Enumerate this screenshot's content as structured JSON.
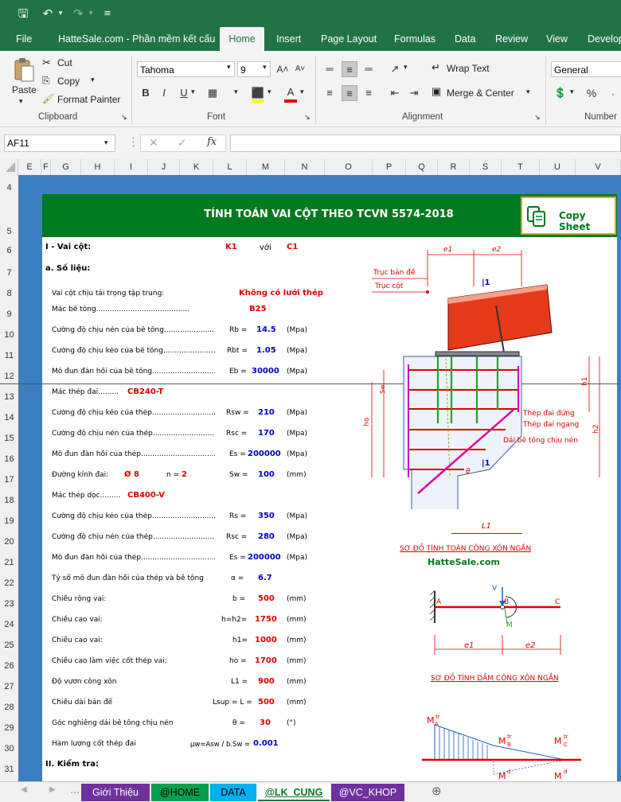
{
  "ribbon_tabs": [
    "File",
    "HatteSale.com - Phần mềm kết cấu",
    "Home",
    "Insert",
    "Page Layout",
    "Formulas",
    "Data",
    "Review",
    "View",
    "Developer"
  ],
  "clipboard": {
    "paste": "Paste",
    "cut": "Cut",
    "copy": "Copy",
    "format_painter": "Format Painter",
    "group": "Clipboard"
  },
  "font": {
    "name": "Tahoma",
    "size": "9",
    "group": "Font",
    "bold": "B",
    "italic": "I",
    "underline": "U"
  },
  "alignment": {
    "wrap": "Wrap Text",
    "merge": "Merge & Center",
    "group": "Alignment"
  },
  "number": {
    "format": "General",
    "group": "Number",
    "percent": "%"
  },
  "name_box": "AF11",
  "formula_value": "",
  "col_headers": [
    "E",
    "F",
    "G",
    "H",
    "I",
    "J",
    "K",
    "L",
    "M",
    "N",
    "O",
    "P",
    "Q",
    "R",
    "S",
    "T",
    "U",
    "V"
  ],
  "row_headers": [
    "4",
    "5",
    "6",
    "7",
    "8",
    "9",
    "10",
    "11",
    "12",
    "13",
    "14",
    "15",
    "16",
    "17",
    "18",
    "19",
    "20",
    "21",
    "22",
    "23",
    "24",
    "25",
    "26",
    "27",
    "28",
    "29",
    "30",
    "31"
  ],
  "title": "TÍNH TOÁN VAI CỘT THEO TCVN 5574-2018",
  "copy_sheet": "Copy Sheet",
  "section1": {
    "label": "I - Vai cột:",
    "k": "K1",
    "with": "với",
    "c": "C1",
    "sub": "a.  Số liệu:"
  },
  "rows": [
    {
      "label": "Vai cột chịu tải trọng tập trung:",
      "value": "Không có lưới thép"
    },
    {
      "label": "Mác bê tông.........................................",
      "value": "B25"
    },
    {
      "label": "Cường độ chịu nén của bê tông.......................",
      "sym": "Rb =",
      "value": "14.5",
      "unit": "(Mpa)"
    },
    {
      "label": "Cường độ chịu kéo của bê tông.......................",
      "sym": "Rbt =",
      "value": "1.05",
      "unit": "(Mpa)"
    },
    {
      "label": "Mô đun đàn hồi của bê tông.............................",
      "sym": "Eb =",
      "value": "30000",
      "unit": "(Mpa)"
    },
    {
      "label": "Mác thép đai.........",
      "value": "CB240-T"
    },
    {
      "label": "Cường độ chịu kéo của thép............................",
      "sym": "Rsw =",
      "value": "210",
      "unit": "(Mpa)"
    },
    {
      "label": "Cường độ chịu nén của thép............................",
      "sym": "Rsc =",
      "value": "170",
      "unit": "(Mpa)"
    },
    {
      "label": "Mô đun đàn hồi của thép.................................",
      "sym": "Es =",
      "value": "200000",
      "unit": "(Mpa)"
    },
    {
      "label": "Đường kính đai:",
      "dia": "Ø 8",
      "n": "n =",
      "nval": "2",
      "sym": "Sw =",
      "value": "100",
      "unit": "(mm)"
    },
    {
      "label": "Mác thép dọc.........",
      "value": "CB400-V"
    },
    {
      "label": "Cường độ chịu kéo của thép............................",
      "sym": "Rs =",
      "value": "350",
      "unit": "(Mpa)"
    },
    {
      "label": "Cường độ chịu nén của thép............................",
      "sym": "Rsc =",
      "value": "280",
      "unit": "(Mpa)"
    },
    {
      "label": "Mô đun đàn hồi của thép.................................",
      "sym": "Es =",
      "value": "200000",
      "unit": "(Mpa)"
    },
    {
      "label": "Tỷ số mô đun đàn hồi của thép và bê tông",
      "sym": "α =",
      "value": "6.7",
      "unit": ""
    },
    {
      "label": "Chiều rộng vai:",
      "sym": "b =",
      "value": "500",
      "unit": "(mm)"
    },
    {
      "label": "Chiều cao vai:",
      "sym": "h=h2=",
      "value": "1750",
      "unit": "(mm)"
    },
    {
      "label": "Chiều cao vai:",
      "sym": "h1=",
      "value": "1000",
      "unit": "(mm)"
    },
    {
      "label": "Chiều cao làm việc cốt thép vai:",
      "sym": "ho =",
      "value": "1700",
      "unit": "(mm)"
    },
    {
      "label": "Độ vươn công xôn",
      "sym": "L1 =",
      "value": "900",
      "unit": "(mm)"
    },
    {
      "label": "Chiều dài bản đế",
      "sym": "Lsup = L =",
      "value": "500",
      "unit": "(mm)"
    },
    {
      "label": "Góc nghiêng dải bê tông chịu nén",
      "sym": "θ =",
      "value": "30",
      "unit": "(°)"
    },
    {
      "label": "Hàm lượng cốt thép đai",
      "sym": "μw=Asw / b.Sw =",
      "value": "0.001",
      "unit": ""
    }
  ],
  "section2": "II. Kiểm tra:",
  "diagram1": {
    "truc_ban_de": "Trục bản đế",
    "truc_cot": "Trục cột",
    "thep_dai_dung": "Thép đai đứng",
    "thep_dai_ngang": "Thép đai ngang",
    "dai_be_tong": "Dải bê tông chịu nén",
    "e1": "e1",
    "e2": "e2",
    "i1": "|1",
    "i1b": "|1",
    "h1": "h1",
    "h2": "h2",
    "ho": "ho",
    "l1": "L1",
    "theta": "θ",
    "sw": "Sw",
    "caption": "SƠ ĐỒ TÍNH TOÁN CÔNG XÔN NGẮN",
    "site": "HatteSale.com"
  },
  "diagram2": {
    "a": "A",
    "b": "B",
    "c": "C",
    "v": "V",
    "m": "M",
    "e1": "e1",
    "e2": "e2",
    "caption": "SƠ ĐỒ TÍNH DẦM CÔNG XÔN NGẮN"
  },
  "diagram3": {
    "ma": "M",
    "ma_sub": "A",
    "ma_sup": "tr",
    "mb": "M",
    "mb_sub": "B",
    "mb_sup": "tr",
    "mc": "M",
    "mc_sub": "C",
    "mc_sup": "tr",
    "md": "M",
    "md_sup": "d",
    "md2": "M",
    "md2_sup": "d"
  },
  "sheet_tabs": [
    "Giới Thiệu",
    "@HOME",
    "DATA",
    "@LK_CUNG",
    "@VC_KHOP"
  ],
  "colors": {
    "excel_green": "#217346",
    "banner": "#007a1f",
    "sheet_bg": "#3c7fc1"
  }
}
